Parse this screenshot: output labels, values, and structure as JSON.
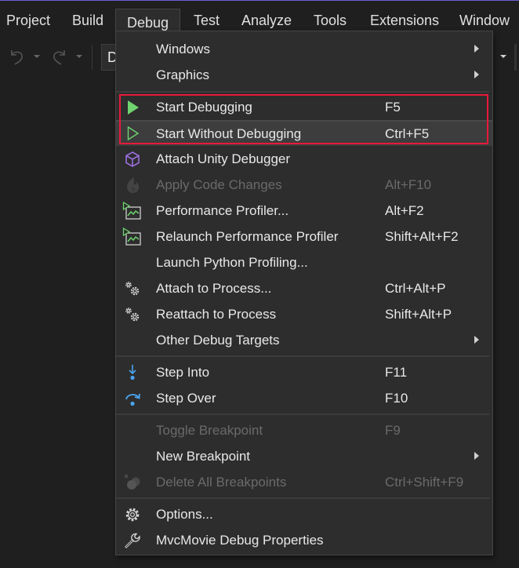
{
  "menubar": {
    "items": [
      {
        "label": "Project"
      },
      {
        "label": "Build"
      },
      {
        "label": "Debug",
        "open": true
      },
      {
        "label": "Test"
      },
      {
        "label": "Analyze"
      },
      {
        "label": "Tools"
      },
      {
        "label": "Extensions"
      },
      {
        "label": "Window"
      }
    ]
  },
  "toolbar": {
    "undo_icon": "undo-icon",
    "redo_icon": "redo-icon",
    "config_text": "D"
  },
  "debug_menu": {
    "items": [
      {
        "label": "Windows",
        "submenu": true
      },
      {
        "label": "Graphics",
        "submenu": true
      },
      {
        "label": "Start Debugging",
        "shortcut": "F5",
        "icon": "play-filled-icon"
      },
      {
        "label": "Start Without Debugging",
        "shortcut": "Ctrl+F5",
        "icon": "play-outline-icon",
        "hovered": true
      },
      {
        "label": "Attach Unity Debugger",
        "icon": "unity-cube-icon"
      },
      {
        "label": "Apply Code Changes",
        "shortcut": "Alt+F10",
        "icon": "hot-reload-flame-icon",
        "disabled": true
      },
      {
        "label": "Performance Profiler...",
        "shortcut": "Alt+F2",
        "icon": "performance-profiler-icon"
      },
      {
        "label": "Relaunch Performance Profiler",
        "shortcut": "Shift+Alt+F2",
        "icon": "performance-profiler-icon"
      },
      {
        "label": "Launch Python Profiling..."
      },
      {
        "label": "Attach to Process...",
        "shortcut": "Ctrl+Alt+P",
        "icon": "gears-icon"
      },
      {
        "label": "Reattach to Process",
        "shortcut": "Shift+Alt+P",
        "icon": "gears-icon"
      },
      {
        "label": "Other Debug Targets",
        "submenu": true
      },
      {
        "label": "Step Into",
        "shortcut": "F11",
        "icon": "step-into-icon"
      },
      {
        "label": "Step Over",
        "shortcut": "F10",
        "icon": "step-over-icon"
      },
      {
        "label": "Toggle Breakpoint",
        "shortcut": "F9",
        "disabled": true
      },
      {
        "label": "New Breakpoint",
        "submenu": true
      },
      {
        "label": "Delete All Breakpoints",
        "shortcut": "Ctrl+Shift+F9",
        "icon": "delete-breakpoints-icon",
        "disabled": true
      },
      {
        "label": "Options...",
        "icon": "gear-icon"
      },
      {
        "label": "MvcMovie Debug Properties",
        "icon": "wrench-icon"
      }
    ]
  },
  "colors": {
    "highlight_box": "#e8193a",
    "play_green": "#6fd36f",
    "unity_purple": "#9b6fe0",
    "step_blue": "#4aa3f0"
  }
}
